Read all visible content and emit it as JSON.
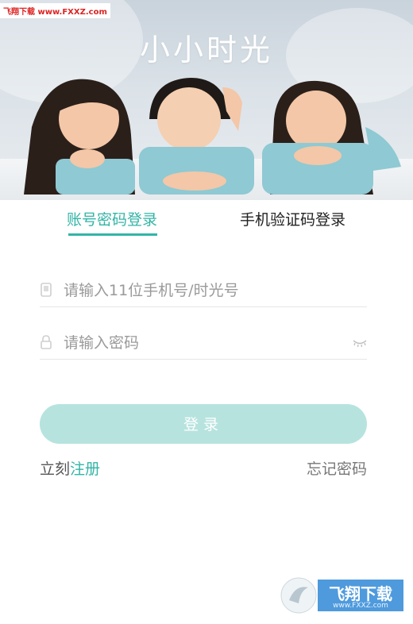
{
  "watermark_top": "飞翔下载 www.FXXZ.com",
  "app_title": "小小时光",
  "tabs": [
    {
      "label": "账号密码登录",
      "active": true
    },
    {
      "label": "手机验证码登录",
      "active": false
    }
  ],
  "phone_field": {
    "placeholder": "请输入11位手机号/时光号",
    "value": ""
  },
  "password_field": {
    "placeholder": "请输入密码",
    "value": ""
  },
  "login_label": "登录",
  "register": {
    "prefix": "立刻",
    "link": "注册"
  },
  "forgot_label": "忘记密码",
  "badge": {
    "name": "飞翔下载",
    "url": "www.FXXZ.com"
  },
  "colors": {
    "accent": "#33b5a6",
    "button_bg": "#b7e3df"
  }
}
